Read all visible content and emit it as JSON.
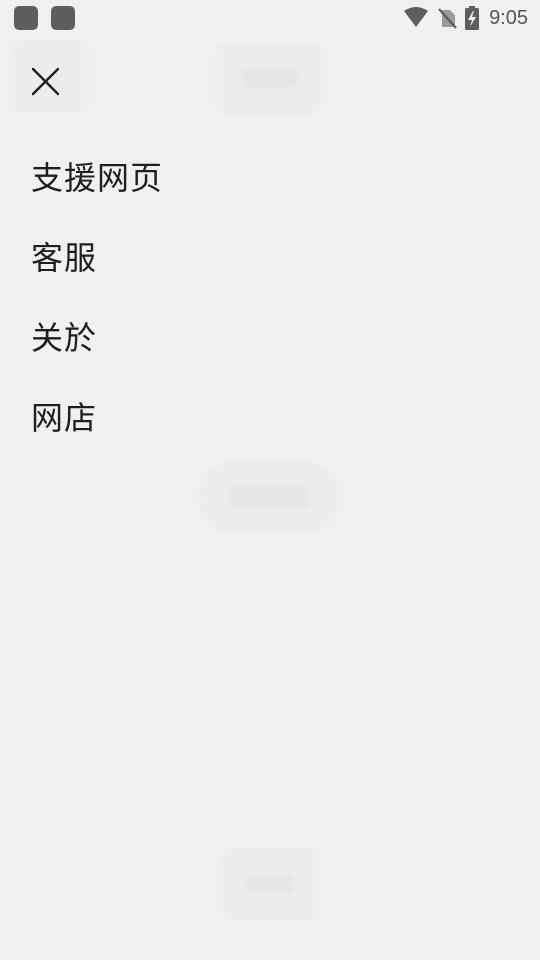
{
  "status_bar": {
    "time": "9:05",
    "icons": [
      "notification-app-icon",
      "notification-app-icon",
      "wifi-icon",
      "no-sim-icon",
      "battery-charging-icon"
    ]
  },
  "header": {
    "close_icon": "close-icon"
  },
  "menu": {
    "items": [
      {
        "label": "支援网页"
      },
      {
        "label": "客服"
      },
      {
        "label": "关於"
      },
      {
        "label": "网店"
      }
    ]
  },
  "colors": {
    "background": "#f0f0f0",
    "text": "#1f1f1f",
    "status_icons": "#5e5e5e"
  }
}
